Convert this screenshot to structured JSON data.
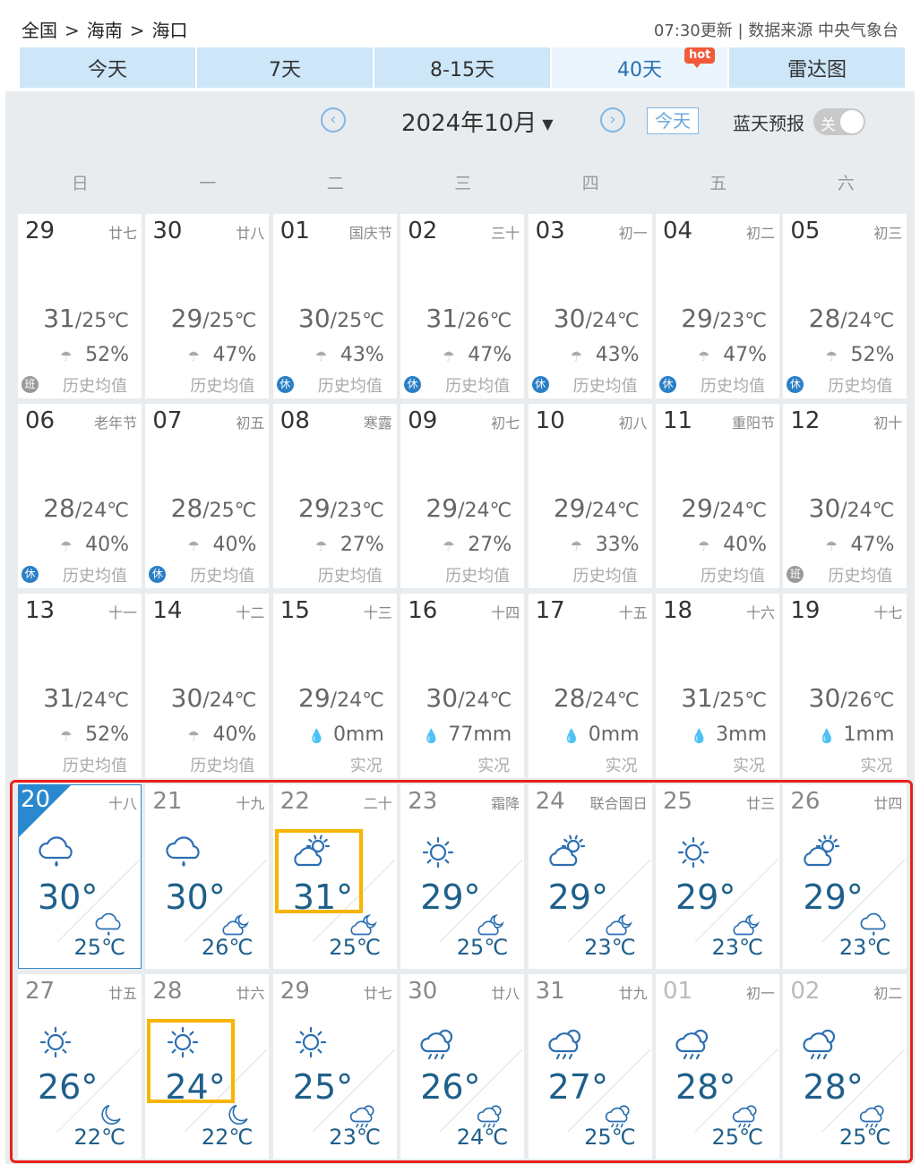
{
  "breadcrumb": [
    "全国",
    "海南",
    "海口"
  ],
  "breadcrumb_sep": ">",
  "update_text": "07:30更新 | 数据来源 中央气象台",
  "tabs": [
    {
      "label": "今天",
      "active": false
    },
    {
      "label": "7天",
      "active": false
    },
    {
      "label": "8-15天",
      "active": false
    },
    {
      "label": "40天",
      "active": true,
      "badge": "hot"
    },
    {
      "label": "雷达图",
      "active": false
    }
  ],
  "nav": {
    "prev_icon": "‹",
    "next_icon": "›",
    "month_label": "2024年10月",
    "caret": "▼",
    "today_button": "今天",
    "bluesky_label": "蓝天预报",
    "toggle_label": "关"
  },
  "weekdays": [
    "日",
    "一",
    "二",
    "三",
    "四",
    "五",
    "六"
  ],
  "history_rows": [
    [
      {
        "day": "29",
        "lunar": "廿七",
        "hi": "31",
        "lo": "/25℃",
        "rain": "52%",
        "note": "历史均值",
        "badge": "班"
      },
      {
        "day": "30",
        "lunar": "廿八",
        "hi": "29",
        "lo": "/25℃",
        "rain": "47%",
        "note": "历史均值",
        "badge": ""
      },
      {
        "day": "01",
        "lunar": "国庆节",
        "hi": "30",
        "lo": "/25℃",
        "rain": "43%",
        "note": "历史均值",
        "badge": "休"
      },
      {
        "day": "02",
        "lunar": "三十",
        "hi": "31",
        "lo": "/26℃",
        "rain": "47%",
        "note": "历史均值",
        "badge": "休"
      },
      {
        "day": "03",
        "lunar": "初一",
        "hi": "30",
        "lo": "/24℃",
        "rain": "43%",
        "note": "历史均值",
        "badge": "休"
      },
      {
        "day": "04",
        "lunar": "初二",
        "hi": "29",
        "lo": "/23℃",
        "rain": "47%",
        "note": "历史均值",
        "badge": "休"
      },
      {
        "day": "05",
        "lunar": "初三",
        "hi": "28",
        "lo": "/24℃",
        "rain": "52%",
        "note": "历史均值",
        "badge": "休"
      }
    ],
    [
      {
        "day": "06",
        "lunar": "老年节",
        "hi": "28",
        "lo": "/24℃",
        "rain": "40%",
        "note": "历史均值",
        "badge": "休"
      },
      {
        "day": "07",
        "lunar": "初五",
        "hi": "28",
        "lo": "/25℃",
        "rain": "40%",
        "note": "历史均值",
        "badge": "休"
      },
      {
        "day": "08",
        "lunar": "寒露",
        "hi": "29",
        "lo": "/23℃",
        "rain": "27%",
        "note": "历史均值",
        "badge": ""
      },
      {
        "day": "09",
        "lunar": "初七",
        "hi": "29",
        "lo": "/24℃",
        "rain": "27%",
        "note": "历史均值",
        "badge": ""
      },
      {
        "day": "10",
        "lunar": "初八",
        "hi": "29",
        "lo": "/24℃",
        "rain": "33%",
        "note": "历史均值",
        "badge": ""
      },
      {
        "day": "11",
        "lunar": "重阳节",
        "hi": "29",
        "lo": "/24℃",
        "rain": "40%",
        "note": "历史均值",
        "badge": ""
      },
      {
        "day": "12",
        "lunar": "初十",
        "hi": "30",
        "lo": "/24℃",
        "rain": "47%",
        "note": "历史均值",
        "badge": "班"
      }
    ],
    [
      {
        "day": "13",
        "lunar": "十一",
        "hi": "31",
        "lo": "/24℃",
        "rain": "52%",
        "note": "历史均值",
        "badge": "",
        "kind": "pct"
      },
      {
        "day": "14",
        "lunar": "十二",
        "hi": "30",
        "lo": "/24℃",
        "rain": "40%",
        "note": "历史均值",
        "badge": "",
        "kind": "pct"
      },
      {
        "day": "15",
        "lunar": "十三",
        "hi": "29",
        "lo": "/24℃",
        "rain": "0mm",
        "note": "实况",
        "badge": "",
        "kind": "mm"
      },
      {
        "day": "16",
        "lunar": "十四",
        "hi": "30",
        "lo": "/24℃",
        "rain": "77mm",
        "note": "实况",
        "badge": "",
        "kind": "mm"
      },
      {
        "day": "17",
        "lunar": "十五",
        "hi": "28",
        "lo": "/24℃",
        "rain": "0mm",
        "note": "实况",
        "badge": "",
        "kind": "mm"
      },
      {
        "day": "18",
        "lunar": "十六",
        "hi": "31",
        "lo": "/25℃",
        "rain": "3mm",
        "note": "实况",
        "badge": "",
        "kind": "mm"
      },
      {
        "day": "19",
        "lunar": "十七",
        "hi": "30",
        "lo": "/26℃",
        "rain": "1mm",
        "note": "实况",
        "badge": "",
        "kind": "mm"
      }
    ]
  ],
  "forecast_rows": [
    [
      {
        "day": "20",
        "lunar": "十八",
        "hi": "30°",
        "lo": "25℃",
        "day_icon": "rain-cloud-icon",
        "night_icon": "rain-cloud-icon",
        "today": true
      },
      {
        "day": "21",
        "lunar": "十九",
        "hi": "30°",
        "lo": "26℃",
        "day_icon": "rain-cloud-icon",
        "night_icon": "cloudy-night-icon"
      },
      {
        "day": "22",
        "lunar": "二十",
        "hi": "31°",
        "lo": "25℃",
        "day_icon": "partly-cloudy-icon",
        "night_icon": "cloudy-night-icon",
        "highlight": true
      },
      {
        "day": "23",
        "lunar": "霜降",
        "hi": "29°",
        "lo": "25℃",
        "day_icon": "sun-icon",
        "night_icon": "cloudy-night-icon"
      },
      {
        "day": "24",
        "lunar": "联合国日",
        "hi": "29°",
        "lo": "23℃",
        "day_icon": "partly-cloudy-icon",
        "night_icon": "cloudy-night-icon"
      },
      {
        "day": "25",
        "lunar": "廿三",
        "hi": "29°",
        "lo": "23℃",
        "day_icon": "sun-icon",
        "night_icon": "cloudy-night-icon"
      },
      {
        "day": "26",
        "lunar": "廿四",
        "hi": "29°",
        "lo": "23℃",
        "day_icon": "partly-cloudy-icon",
        "night_icon": "rain-cloud-icon"
      }
    ],
    [
      {
        "day": "27",
        "lunar": "廿五",
        "hi": "26°",
        "lo": "22℃",
        "day_icon": "sun-icon",
        "night_icon": "moon-icon"
      },
      {
        "day": "28",
        "lunar": "廿六",
        "hi": "24°",
        "lo": "22℃",
        "day_icon": "sun-icon",
        "night_icon": "moon-icon",
        "highlight": true
      },
      {
        "day": "29",
        "lunar": "廿七",
        "hi": "25°",
        "lo": "23℃",
        "day_icon": "sun-icon",
        "night_icon": "shower-icon"
      },
      {
        "day": "30",
        "lunar": "廿八",
        "hi": "26°",
        "lo": "24℃",
        "day_icon": "shower-icon",
        "night_icon": "shower-icon"
      },
      {
        "day": "31",
        "lunar": "廿九",
        "hi": "27°",
        "lo": "25℃",
        "day_icon": "shower-icon",
        "night_icon": "shower-icon"
      },
      {
        "day": "01",
        "lunar": "初一",
        "hi": "28°",
        "lo": "25℃",
        "day_icon": "shower-icon",
        "night_icon": "shower-icon",
        "dim": true
      },
      {
        "day": "02",
        "lunar": "初二",
        "hi": "28°",
        "lo": "25℃",
        "day_icon": "shower-icon",
        "night_icon": "shower-icon",
        "dim": true
      }
    ]
  ],
  "colors": {
    "tab_bg": "#cde6f8",
    "accent": "#2c6fb2",
    "forecast_text": "#1f5f8b",
    "highlight": "#f7b500",
    "red_box": "#e8221b",
    "badge": "#2a7fc6"
  }
}
